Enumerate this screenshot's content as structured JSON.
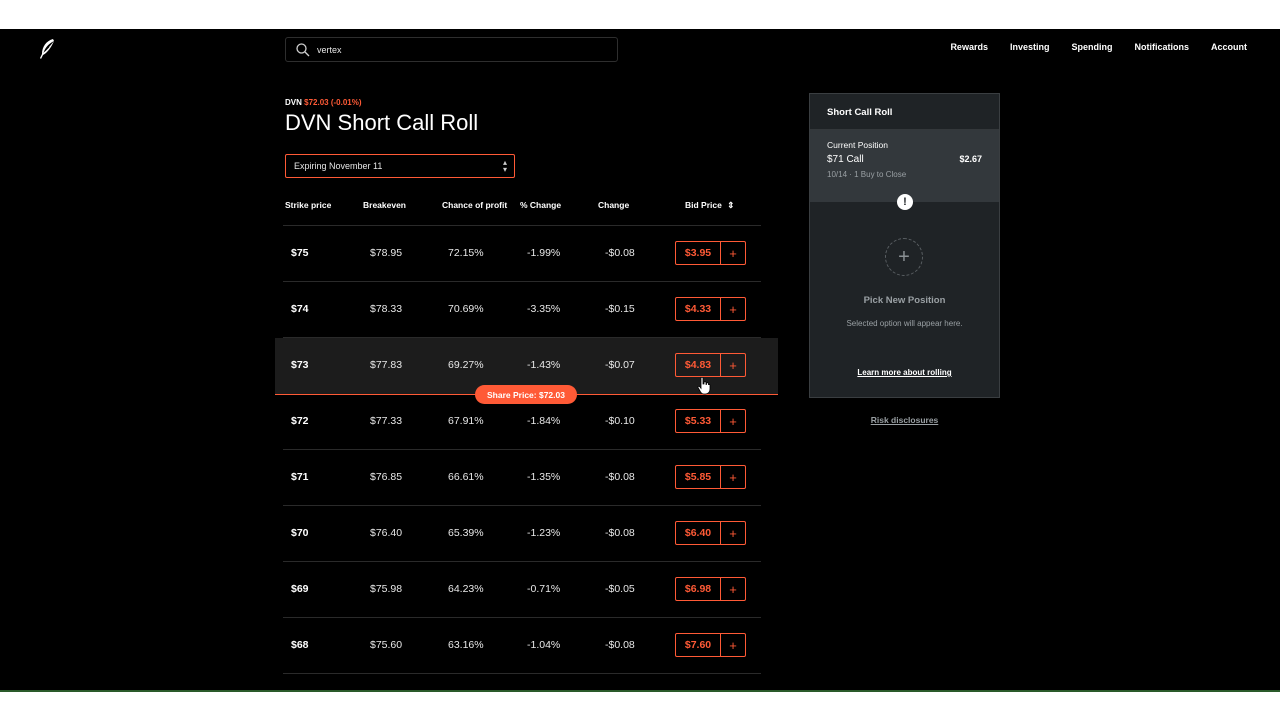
{
  "search": {
    "value": "vertex"
  },
  "nav": [
    "Rewards",
    "Investing",
    "Spending",
    "Notifications",
    "Account"
  ],
  "ticker": {
    "symbol": "DVN",
    "price": "$72.03 (-0.01%)"
  },
  "title": "DVN Short Call Roll",
  "expiry": {
    "selected": "Expiring November 11"
  },
  "table": {
    "headers": {
      "strike": "Strike price",
      "breakeven": "Breakeven",
      "chance": "Chance of profit",
      "pct_change": "% Change",
      "change": "Change",
      "bid": "Bid Price",
      "bid_sort": "⇕"
    },
    "rows": [
      {
        "strike": "$75",
        "breakeven": "$78.95",
        "chance": "72.15%",
        "pct_change": "-1.99%",
        "change": "-$0.08",
        "bid": "$3.95",
        "add": "+"
      },
      {
        "strike": "$74",
        "breakeven": "$78.33",
        "chance": "70.69%",
        "pct_change": "-3.35%",
        "change": "-$0.15",
        "bid": "$4.33",
        "add": "+"
      },
      {
        "strike": "$73",
        "breakeven": "$77.83",
        "chance": "69.27%",
        "pct_change": "-1.43%",
        "change": "-$0.07",
        "bid": "$4.83",
        "add": "+",
        "highlighted": true
      },
      {
        "strike": "$72",
        "breakeven": "$77.33",
        "chance": "67.91%",
        "pct_change": "-1.84%",
        "change": "-$0.10",
        "bid": "$5.33",
        "add": "+"
      },
      {
        "strike": "$71",
        "breakeven": "$76.85",
        "chance": "66.61%",
        "pct_change": "-1.35%",
        "change": "-$0.08",
        "bid": "$5.85",
        "add": "+"
      },
      {
        "strike": "$70",
        "breakeven": "$76.40",
        "chance": "65.39%",
        "pct_change": "-1.23%",
        "change": "-$0.08",
        "bid": "$6.40",
        "add": "+"
      },
      {
        "strike": "$69",
        "breakeven": "$75.98",
        "chance": "64.23%",
        "pct_change": "-0.71%",
        "change": "-$0.05",
        "bid": "$6.98",
        "add": "+"
      },
      {
        "strike": "$68",
        "breakeven": "$75.60",
        "chance": "63.16%",
        "pct_change": "-1.04%",
        "change": "-$0.08",
        "bid": "$7.60",
        "add": "+"
      }
    ],
    "share_price_label": "Share Price: $72.03"
  },
  "panel": {
    "title": "Short Call Roll",
    "current_label": "Current Position",
    "current_name": "$71 Call",
    "current_price": "$2.67",
    "current_sub": "10/14 · 1 Buy to Close",
    "alert": "!",
    "add": "+",
    "pick_title": "Pick New Position",
    "pick_sub": "Selected option will appear here.",
    "learn_link": "Learn more about rolling"
  },
  "risk_link": "Risk disclosures",
  "colors": {
    "accent": "#ff5a36",
    "panel_bg": "#1f2326",
    "background": "#000000"
  },
  "icons": {
    "logo": "feather-logo-icon",
    "search": "search-icon",
    "cursor": "pointer-cursor-icon"
  }
}
